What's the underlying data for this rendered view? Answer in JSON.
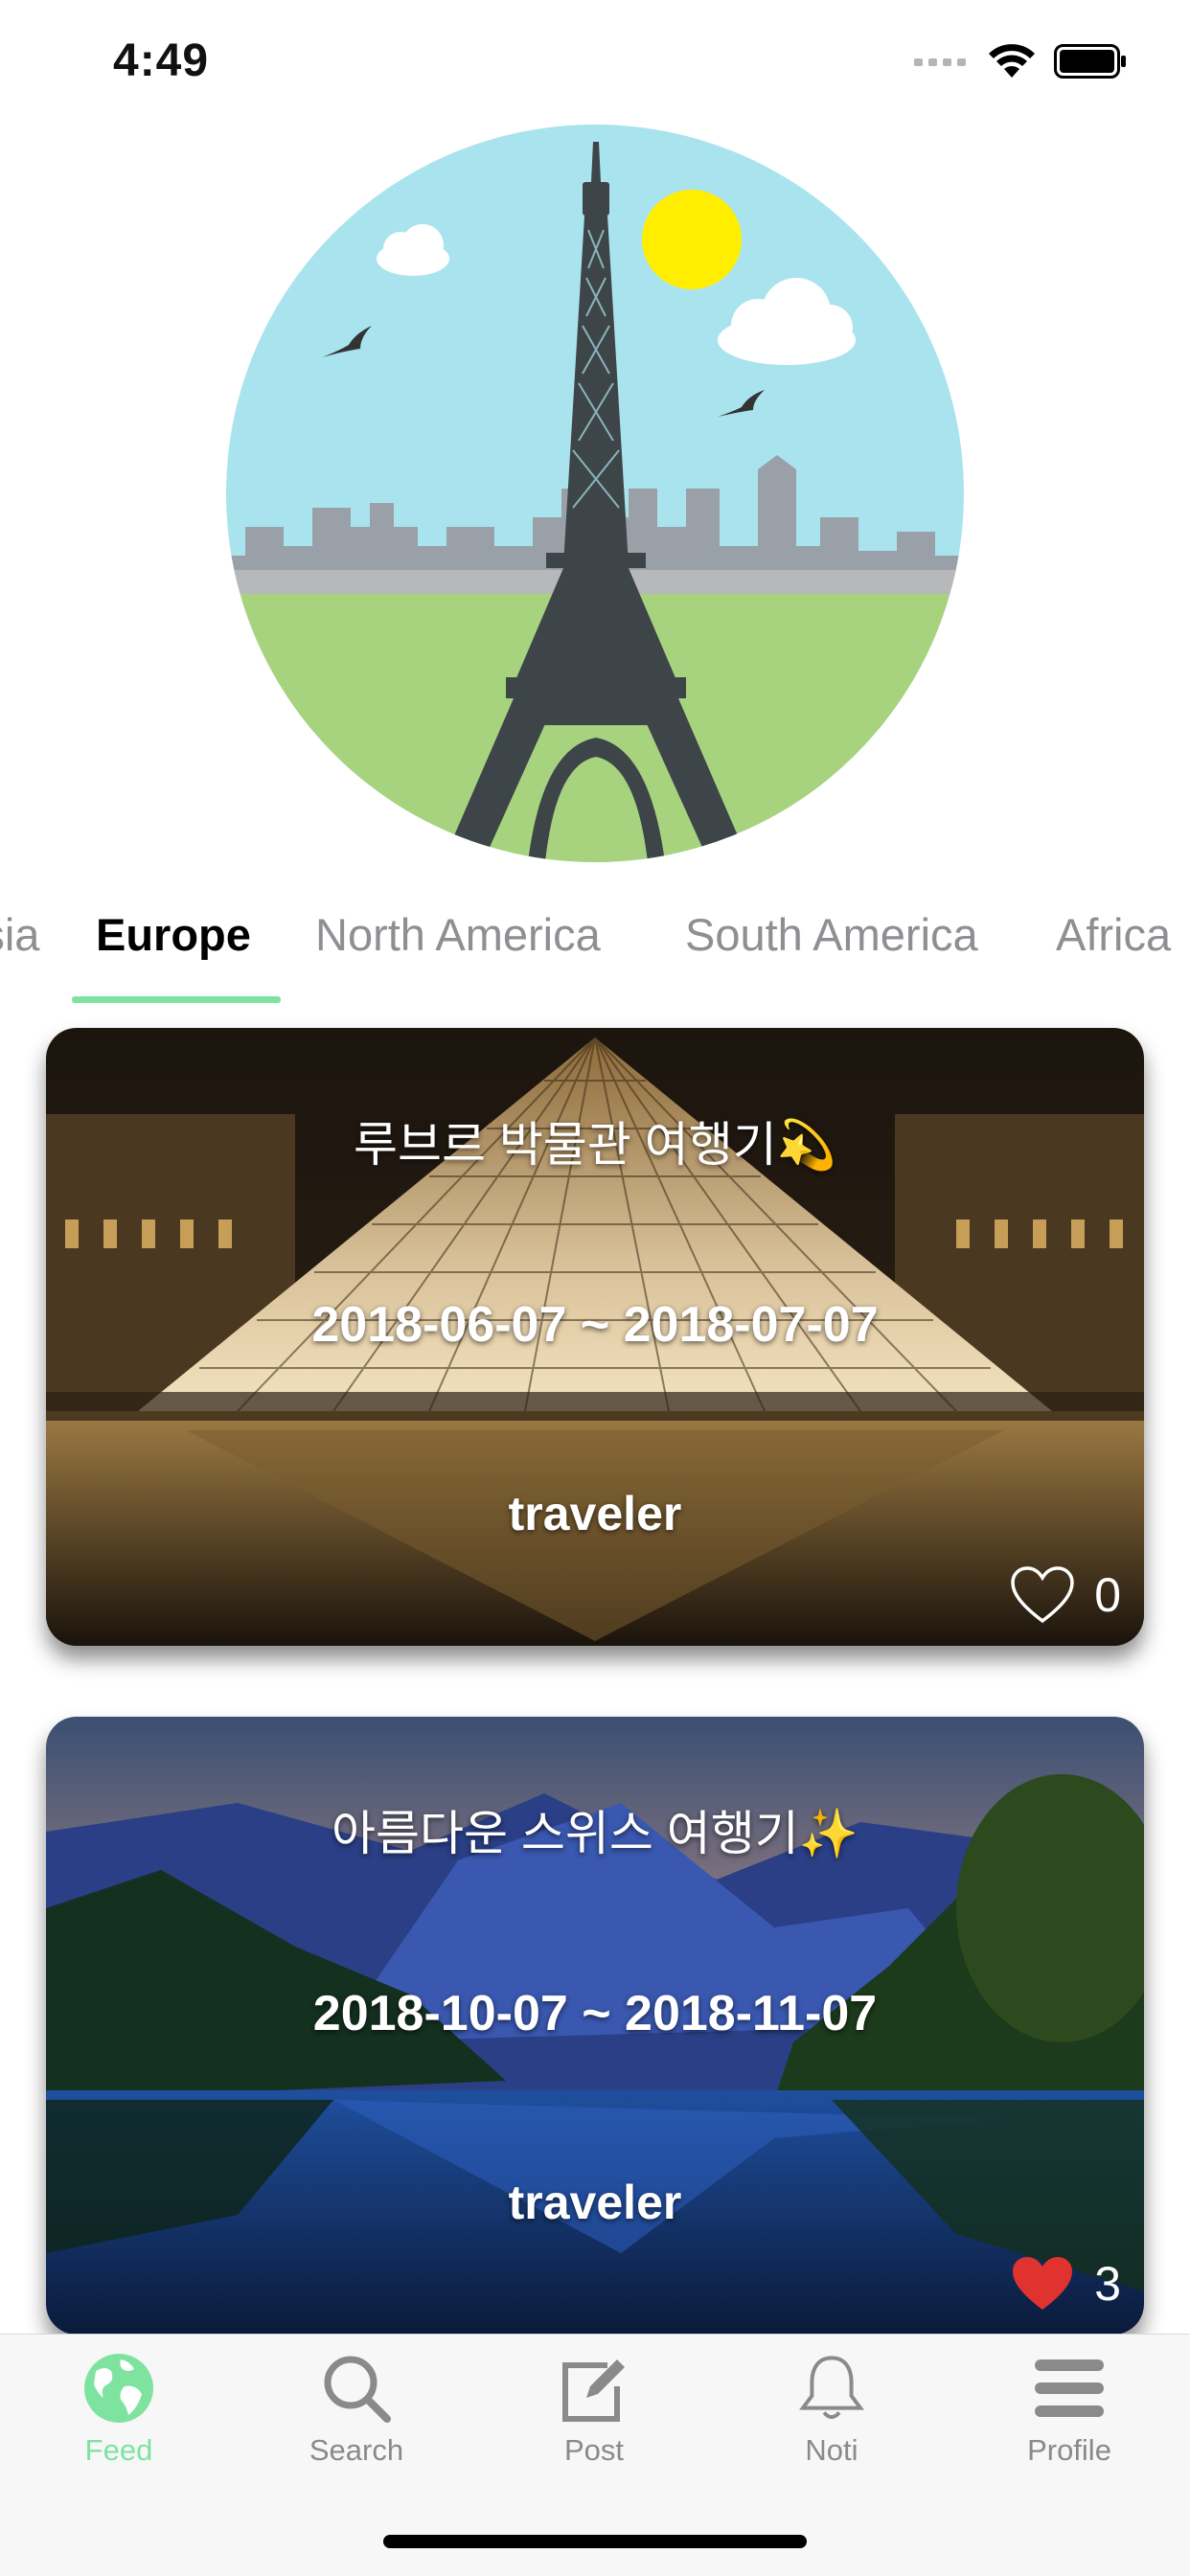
{
  "status_bar": {
    "time": "4:49"
  },
  "region_tabs": {
    "items": [
      {
        "label": "Asia",
        "active": false
      },
      {
        "label": "Europe",
        "active": true
      },
      {
        "label": "North America",
        "active": false
      },
      {
        "label": "South America",
        "active": false
      },
      {
        "label": "Africa",
        "active": false
      }
    ]
  },
  "feed": {
    "cards": [
      {
        "title": "루브르 박물관 여행기💫",
        "dates": "2018-06-07 ~ 2018-07-07",
        "author": "traveler",
        "likes": "0",
        "liked": false
      },
      {
        "title": "아름다운 스위스 여행기✨",
        "dates": "2018-10-07 ~ 2018-11-07",
        "author": "traveler",
        "likes": "3",
        "liked": true
      }
    ]
  },
  "tab_bar": {
    "items": [
      {
        "label": "Feed",
        "icon": "globe-icon",
        "active": true
      },
      {
        "label": "Search",
        "icon": "search-icon",
        "active": false
      },
      {
        "label": "Post",
        "icon": "edit-icon",
        "active": false
      },
      {
        "label": "Noti",
        "icon": "bell-icon",
        "active": false
      },
      {
        "label": "Profile",
        "icon": "menu-icon",
        "active": false
      }
    ]
  },
  "colors": {
    "accent": "#7fe3a0",
    "like_red": "#e0322f"
  }
}
